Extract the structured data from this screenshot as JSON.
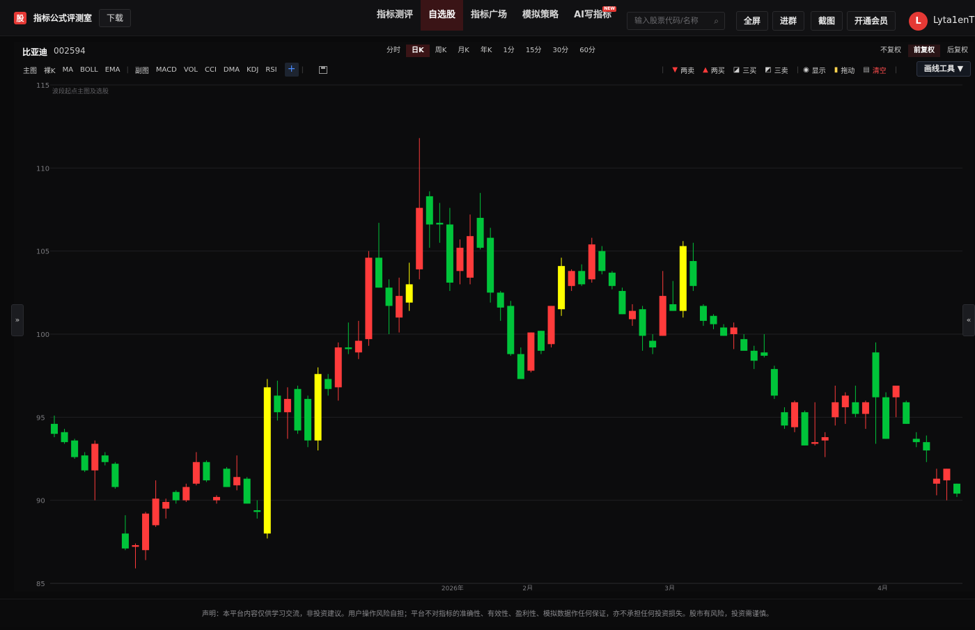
{
  "brand": {
    "logo_text": "股",
    "name": "指标公式评测室",
    "download": "下载"
  },
  "nav": {
    "items": [
      {
        "label": "指标测评",
        "active": false
      },
      {
        "label": "自选股",
        "active": true
      },
      {
        "label": "指标广场",
        "active": false
      },
      {
        "label": "模拟策略",
        "active": false
      },
      {
        "label": "AI写指标",
        "active": false,
        "badge": "NEW"
      }
    ]
  },
  "search": {
    "placeholder": "输入股票代码/名称",
    "icon": "search-icon"
  },
  "top_buttons": [
    "全屏",
    "进群",
    "截图",
    "开通会员"
  ],
  "user": {
    "avatar_letter": "L",
    "name": "Lyta1enT"
  },
  "stock": {
    "name": "比亚迪",
    "code": "002594"
  },
  "periods": [
    "分时",
    "日K",
    "周K",
    "月K",
    "年K",
    "1分",
    "15分",
    "30分",
    "60分"
  ],
  "active_period": "日K",
  "adjust": [
    "不复权",
    "前复权",
    "后复权"
  ],
  "active_adjust": "前复权",
  "main_indicators": {
    "label": "主图",
    "items": [
      "裸K",
      "MA",
      "BOLL",
      "EMA"
    ]
  },
  "sub_indicators": {
    "label": "副图",
    "items": [
      "MACD",
      "VOL",
      "CCI",
      "DMA",
      "KDJ",
      "RSI"
    ]
  },
  "add_label": "+",
  "tools": [
    {
      "icon": "▼",
      "label": "两卖",
      "color": "#ff3b3b"
    },
    {
      "icon": "▲",
      "label": "两买",
      "color": "#ff3b3b"
    },
    {
      "icon": "◪",
      "label": "三买",
      "color": "#ffffff"
    },
    {
      "icon": "◩",
      "label": "三卖",
      "color": "#ffffff"
    },
    {
      "icon": "◉",
      "label": "显示",
      "color": "#ffffff"
    },
    {
      "icon": "🔒",
      "label": "拖动",
      "color": "#ffd54f"
    },
    {
      "icon": "🗑",
      "label": "清空",
      "color": "#ff4d4d"
    }
  ],
  "draw_tools_label": "画线工具 ▼",
  "side_left": "»",
  "side_right": "«",
  "chart_note": "波段起点主图及选股",
  "footer": "声明：本平台内容仅供学习交流，非投资建议。用户操作风险自担；平台不对指标的准确性、有效性、盈利性、模拟数据作任何保证，亦不承担任何投资损失。股市有风险，投资需谨慎。",
  "chart_data": {
    "type": "candlestick",
    "ylim": [
      85,
      115
    ],
    "yticks": [
      85,
      90,
      95,
      100,
      105,
      110,
      115
    ],
    "xticks": [
      {
        "i": 39,
        "label": "2026年"
      },
      {
        "i": 47,
        "label": "2月"
      },
      {
        "i": 61,
        "label": "3月"
      },
      {
        "i": 82,
        "label": "4月"
      }
    ],
    "colors": {
      "up": "#ff3b3b",
      "down": "#00c43a",
      "special": "#ffff00"
    },
    "candles": [
      {
        "o": 94.6,
        "h": 95.1,
        "l": 93.8,
        "c": 94.0,
        "t": "down"
      },
      {
        "o": 94.1,
        "h": 94.3,
        "l": 93.4,
        "c": 93.5,
        "t": "down"
      },
      {
        "o": 93.6,
        "h": 93.7,
        "l": 92.5,
        "c": 92.6,
        "t": "down"
      },
      {
        "o": 92.7,
        "h": 92.9,
        "l": 91.7,
        "c": 91.8,
        "t": "down"
      },
      {
        "o": 91.8,
        "h": 93.6,
        "l": 90.0,
        "c": 93.4,
        "t": "up"
      },
      {
        "o": 92.7,
        "h": 92.9,
        "l": 92.1,
        "c": 92.3,
        "t": "down"
      },
      {
        "o": 92.2,
        "h": 92.3,
        "l": 90.7,
        "c": 90.8,
        "t": "down"
      },
      {
        "o": 88.0,
        "h": 89.1,
        "l": 87.0,
        "c": 87.1,
        "t": "down"
      },
      {
        "o": 87.2,
        "h": 87.4,
        "l": 85.9,
        "c": 87.3,
        "t": "up"
      },
      {
        "o": 87.0,
        "h": 89.3,
        "l": 86.4,
        "c": 89.2,
        "t": "up"
      },
      {
        "o": 88.5,
        "h": 91.2,
        "l": 88.4,
        "c": 90.1,
        "t": "up"
      },
      {
        "o": 89.5,
        "h": 90.1,
        "l": 88.9,
        "c": 89.9,
        "t": "up"
      },
      {
        "o": 90.5,
        "h": 90.6,
        "l": 89.8,
        "c": 90.0,
        "t": "down"
      },
      {
        "o": 90.0,
        "h": 91.0,
        "l": 89.9,
        "c": 90.8,
        "t": "up"
      },
      {
        "o": 91.0,
        "h": 92.9,
        "l": 90.9,
        "c": 92.3,
        "t": "up"
      },
      {
        "o": 92.3,
        "h": 92.4,
        "l": 91.1,
        "c": 91.2,
        "t": "down"
      },
      {
        "o": 90.0,
        "h": 90.3,
        "l": 89.8,
        "c": 90.2,
        "t": "up"
      },
      {
        "o": 91.9,
        "h": 92.0,
        "l": 90.8,
        "c": 90.8,
        "t": "down"
      },
      {
        "o": 90.9,
        "h": 92.7,
        "l": 90.6,
        "c": 91.4,
        "t": "up"
      },
      {
        "o": 91.3,
        "h": 91.4,
        "l": 89.8,
        "c": 89.8,
        "t": "down"
      },
      {
        "o": 89.4,
        "h": 90.0,
        "l": 88.9,
        "c": 89.3,
        "t": "down"
      },
      {
        "o": 96.8,
        "h": 97.3,
        "l": 87.7,
        "c": 88.0,
        "t": "special"
      },
      {
        "o": 96.3,
        "h": 97.2,
        "l": 94.8,
        "c": 95.3,
        "t": "down"
      },
      {
        "o": 95.3,
        "h": 96.8,
        "l": 93.7,
        "c": 96.1,
        "t": "up"
      },
      {
        "o": 96.7,
        "h": 96.9,
        "l": 94.0,
        "c": 94.2,
        "t": "down"
      },
      {
        "o": 96.1,
        "h": 96.3,
        "l": 93.2,
        "c": 93.6,
        "t": "down"
      },
      {
        "o": 93.6,
        "h": 98.0,
        "l": 93.0,
        "c": 97.6,
        "t": "special"
      },
      {
        "o": 97.3,
        "h": 97.6,
        "l": 96.3,
        "c": 96.7,
        "t": "down"
      },
      {
        "o": 96.8,
        "h": 99.5,
        "l": 96.0,
        "c": 99.2,
        "t": "up"
      },
      {
        "o": 99.2,
        "h": 100.7,
        "l": 98.8,
        "c": 99.1,
        "t": "down"
      },
      {
        "o": 98.9,
        "h": 100.8,
        "l": 98.5,
        "c": 99.6,
        "t": "up"
      },
      {
        "o": 99.7,
        "h": 105.0,
        "l": 99.3,
        "c": 104.6,
        "t": "up"
      },
      {
        "o": 104.6,
        "h": 106.7,
        "l": 102.8,
        "c": 102.8,
        "t": "down"
      },
      {
        "o": 102.8,
        "h": 103.3,
        "l": 100.0,
        "c": 101.7,
        "t": "down"
      },
      {
        "o": 101.0,
        "h": 103.4,
        "l": 100.1,
        "c": 102.3,
        "t": "up"
      },
      {
        "o": 101.9,
        "h": 104.3,
        "l": 101.4,
        "c": 103.0,
        "t": "special"
      },
      {
        "o": 103.9,
        "h": 111.8,
        "l": 103.3,
        "c": 107.6,
        "t": "up"
      },
      {
        "o": 108.3,
        "h": 108.6,
        "l": 105.2,
        "c": 106.6,
        "t": "down"
      },
      {
        "o": 106.6,
        "h": 107.9,
        "l": 105.5,
        "c": 106.7,
        "t": "down"
      },
      {
        "o": 106.6,
        "h": 107.6,
        "l": 102.6,
        "c": 103.1,
        "t": "down"
      },
      {
        "o": 103.8,
        "h": 105.7,
        "l": 103.0,
        "c": 105.2,
        "t": "up"
      },
      {
        "o": 103.4,
        "h": 107.2,
        "l": 103.0,
        "c": 105.9,
        "t": "up"
      },
      {
        "o": 107.0,
        "h": 108.5,
        "l": 105.1,
        "c": 105.2,
        "t": "down"
      },
      {
        "o": 105.8,
        "h": 106.4,
        "l": 101.9,
        "c": 102.5,
        "t": "down"
      },
      {
        "o": 102.5,
        "h": 102.6,
        "l": 100.8,
        "c": 101.6,
        "t": "down"
      },
      {
        "o": 101.7,
        "h": 102.0,
        "l": 98.7,
        "c": 98.8,
        "t": "down"
      },
      {
        "o": 98.8,
        "h": 99.2,
        "l": 97.6,
        "c": 97.3,
        "t": "down"
      },
      {
        "o": 97.8,
        "h": 100.1,
        "l": 97.7,
        "c": 100.1,
        "t": "up"
      },
      {
        "o": 100.2,
        "h": 100.2,
        "l": 98.8,
        "c": 99.0,
        "t": "down"
      },
      {
        "o": 99.4,
        "h": 101.7,
        "l": 99.2,
        "c": 101.7,
        "t": "up"
      },
      {
        "o": 101.5,
        "h": 104.6,
        "l": 101.1,
        "c": 104.1,
        "t": "special"
      },
      {
        "o": 102.9,
        "h": 103.9,
        "l": 102.6,
        "c": 103.8,
        "t": "up"
      },
      {
        "o": 103.8,
        "h": 104.2,
        "l": 102.9,
        "c": 103.0,
        "t": "down"
      },
      {
        "o": 103.3,
        "h": 105.8,
        "l": 103.1,
        "c": 105.4,
        "t": "up"
      },
      {
        "o": 105.0,
        "h": 105.3,
        "l": 103.6,
        "c": 103.8,
        "t": "down"
      },
      {
        "o": 103.7,
        "h": 103.8,
        "l": 102.7,
        "c": 102.9,
        "t": "down"
      },
      {
        "o": 102.6,
        "h": 102.8,
        "l": 101.2,
        "c": 101.2,
        "t": "down"
      },
      {
        "o": 100.9,
        "h": 101.8,
        "l": 100.5,
        "c": 101.4,
        "t": "up"
      },
      {
        "o": 101.5,
        "h": 101.7,
        "l": 99.0,
        "c": 99.9,
        "t": "down"
      },
      {
        "o": 99.6,
        "h": 100.0,
        "l": 98.8,
        "c": 99.2,
        "t": "down"
      },
      {
        "o": 99.9,
        "h": 103.8,
        "l": 99.9,
        "c": 102.3,
        "t": "up"
      },
      {
        "o": 101.8,
        "h": 103.2,
        "l": 101.4,
        "c": 101.4,
        "t": "down"
      },
      {
        "o": 105.3,
        "h": 105.6,
        "l": 101.0,
        "c": 101.4,
        "t": "special"
      },
      {
        "o": 104.4,
        "h": 105.5,
        "l": 102.6,
        "c": 102.9,
        "t": "down"
      },
      {
        "o": 101.7,
        "h": 101.8,
        "l": 100.5,
        "c": 100.8,
        "t": "down"
      },
      {
        "o": 101.1,
        "h": 101.2,
        "l": 100.3,
        "c": 100.6,
        "t": "down"
      },
      {
        "o": 100.4,
        "h": 100.6,
        "l": 99.9,
        "c": 99.9,
        "t": "down"
      },
      {
        "o": 100.0,
        "h": 100.7,
        "l": 99.1,
        "c": 100.4,
        "t": "up"
      },
      {
        "o": 99.7,
        "h": 100.0,
        "l": 99.2,
        "c": 99.0,
        "t": "down"
      },
      {
        "o": 99.0,
        "h": 99.3,
        "l": 97.9,
        "c": 98.4,
        "t": "down"
      },
      {
        "o": 98.9,
        "h": 100.0,
        "l": 98.6,
        "c": 98.7,
        "t": "down"
      },
      {
        "o": 97.9,
        "h": 98.1,
        "l": 96.1,
        "c": 96.3,
        "t": "down"
      },
      {
        "o": 95.3,
        "h": 95.6,
        "l": 94.3,
        "c": 94.5,
        "t": "down"
      },
      {
        "o": 94.4,
        "h": 96.0,
        "l": 94.1,
        "c": 95.9,
        "t": "up"
      },
      {
        "o": 95.3,
        "h": 95.4,
        "l": 93.3,
        "c": 93.3,
        "t": "down"
      },
      {
        "o": 93.4,
        "h": 95.9,
        "l": 93.3,
        "c": 93.5,
        "t": "up"
      },
      {
        "o": 93.6,
        "h": 94.1,
        "l": 92.6,
        "c": 93.8,
        "t": "up"
      },
      {
        "o": 95.0,
        "h": 96.9,
        "l": 94.5,
        "c": 95.9,
        "t": "up"
      },
      {
        "o": 95.6,
        "h": 96.5,
        "l": 94.6,
        "c": 96.3,
        "t": "up"
      },
      {
        "o": 95.9,
        "h": 96.9,
        "l": 95.0,
        "c": 95.2,
        "t": "down"
      },
      {
        "o": 95.2,
        "h": 96.0,
        "l": 94.3,
        "c": 95.9,
        "t": "up"
      },
      {
        "o": 98.9,
        "h": 99.5,
        "l": 93.4,
        "c": 96.2,
        "t": "down"
      },
      {
        "o": 96.2,
        "h": 96.5,
        "l": 93.7,
        "c": 93.7,
        "t": "down"
      },
      {
        "o": 96.2,
        "h": 96.9,
        "l": 95.0,
        "c": 96.9,
        "t": "up"
      },
      {
        "o": 95.9,
        "h": 96.0,
        "l": 94.6,
        "c": 94.6,
        "t": "down"
      },
      {
        "o": 93.7,
        "h": 94.1,
        "l": 93.2,
        "c": 93.5,
        "t": "down"
      },
      {
        "o": 93.5,
        "h": 93.9,
        "l": 92.3,
        "c": 93.0,
        "t": "down"
      },
      {
        "o": 91.0,
        "h": 91.9,
        "l": 90.3,
        "c": 91.3,
        "t": "up"
      },
      {
        "o": 91.2,
        "h": 91.9,
        "l": 90.0,
        "c": 91.9,
        "t": "up"
      },
      {
        "o": 91.0,
        "h": 91.0,
        "l": 90.2,
        "c": 90.4,
        "t": "down"
      }
    ]
  }
}
